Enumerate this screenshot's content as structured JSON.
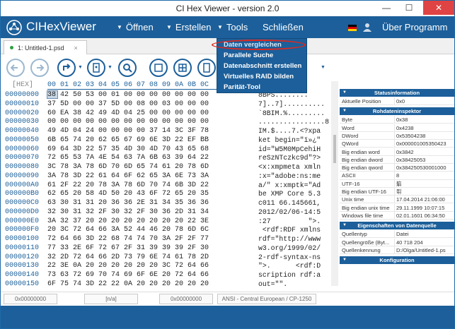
{
  "window": {
    "title": "CI Hex Viewer - version 2.0",
    "min": "—",
    "max": "☐",
    "close": "✕"
  },
  "menubar": {
    "app_name": "CIHexViewer",
    "menus": [
      "Öffnen",
      "Erstellen",
      "Tools",
      "Schließen"
    ],
    "about": "Über Programm",
    "tri": "▼",
    "colors": {
      "bar": "#1c5f9a",
      "highlight_ring": "#e0281e"
    }
  },
  "tab": {
    "label": "1: Untitled-1.psd",
    "close": "×"
  },
  "tools_menu": {
    "items": [
      "Daten vergleichen",
      "Parallele Suche",
      "Datenabschnitt erstellen",
      "Virtuelles RAID bilden",
      "Parität-Tool"
    ]
  },
  "hex": {
    "header_label": "[HEX]",
    "header_cols": "00 01 02 03 04 05 06 07 08 09 0A 0B 0C",
    "offsets": [
      "00000000",
      "00000010",
      "00000020",
      "00000030",
      "00000040",
      "00000050",
      "00000060",
      "00000070",
      "00000080",
      "00000090",
      "000000A0",
      "000000B0",
      "000000C0",
      "000000D0",
      "000000E0",
      "000000F0",
      "00000100",
      "00000110",
      "00000120",
      "00000130",
      "00000140",
      "00000150"
    ],
    "rows": [
      "38 42 50 53 00 01 00 00 00 00 00 00 00",
      "37 5D 00 00 37 5D 00 08 00 03 00 00 00",
      "60 EA 38 42 49 4D 04 25 00 00 00 00 00",
      "00 00 00 00 00 00 00 00 00 00 00 00 00",
      "49 4D 04 24 00 00 00 00 37 14 3C 3F 78",
      "6B 65 74 20 62 65 67 69 6E 3D 22 EF BB",
      "69 64 3D 22 57 35 4D 30 4D 70 43 65 68",
      "72 65 53 7A 4E 54 63 7A 6B 63 39 64 22",
      "3C 78 3A 78 6D 70 6D 65 74 61 20 78 6D",
      "3A 78 3D 22 61 64 6F 62 65 3A 6E 73 3A",
      "61 2F 22 20 78 3A 78 6D 70 74 6B 3D 22",
      "62 65 20 58 4D 50 20 43 6F 72 65 20 35",
      "63 30 31 31 20 36 36 2E 31 34 35 36 36",
      "32 30 31 32 2F 30 32 2F 30 36 2D 31 34",
      "3A 32 37 20 20 20 20 20 20 20 20 22 3E",
      "20 3C 72 64 66 3A 52 44 46 20 78 6D 6C",
      "72 64 66 3D 22 68 74 74 70 3A 2F 2F 77",
      "77 33 2E 6F 72 67 2F 31 39 39 39 2F 30",
      "32 2D 72 64 66 2D 73 79 6E 74 61 78 2D",
      "22 3E 0A 20 20 20 20 20 20 3C 72 64 66",
      "73 63 72 69 70 74 69 6F 6E 20 72 64 66",
      "6F 75 74 3D 22 22 0A 20 20 20 20 20 20"
    ],
    "text": [
      "8BPS........",
      "7]..7]..........",
      "`8BIM.%.........",
      "................8",
      "IM.$....7.<?xpa",
      "ket begin=\"ï»¿\"",
      "id=\"W5M0MpCehiH",
      "reSzNTczkc9d\"?>",
      "<x:xmpmeta xmln",
      ":x=\"adobe:ns:me",
      "a/\" x:xmptk=\"Ad",
      "be XMP Core 5.3",
      "c011 66.145661,",
      "2012/02/06-14:5",
      ":27         \">.",
      " <rdf:RDF xmlns",
      "rdf=\"http://www",
      "w3.org/1999/02/",
      "2-rdf-syntax-ns",
      "\">.      <rdf:D",
      "scription rdf:a",
      "out=\"\"."
    ]
  },
  "panel": {
    "sections": [
      "Statusinformation",
      "Rohdateninspektor",
      "Eigenschaften von Datenquelle",
      "Konfiguration"
    ],
    "status": [
      [
        "Aktuelle Position",
        "0x0"
      ]
    ],
    "inspector": [
      [
        "Byte",
        "0x38"
      ],
      [
        "Word",
        "0x4238"
      ],
      [
        "DWord",
        "0x53504238"
      ],
      [
        "QWord",
        "0x000001005350423"
      ],
      [
        "Big endian word",
        "0x3842"
      ],
      [
        "Big endian dword",
        "0x38425053"
      ],
      [
        "Big endian qword",
        "0x384250530001000"
      ],
      [
        "ASCII",
        "8"
      ],
      [
        "UTF-16",
        "䈸"
      ],
      [
        "Big endian UTF-16",
        "㡂"
      ],
      [
        "Unix time",
        "17.04.2014 21:06:00"
      ],
      [
        "Big endian unix time",
        "29.11.1999 10:07:15"
      ],
      [
        "Windows file time",
        "02.01.1601 06:34:50"
      ]
    ],
    "source": [
      [
        "Quellentyp",
        "Datei"
      ],
      [
        "Quellengröße (Byt...",
        "40 718 204"
      ],
      [
        "Quellenkennung",
        "D:/Olga/Untitled-1.ps"
      ]
    ]
  },
  "status": {
    "offset": "0x00000000",
    "na": "[n/a]",
    "sel": "0x00000000",
    "encoding": "ANSI - Central European / CP-1250"
  }
}
